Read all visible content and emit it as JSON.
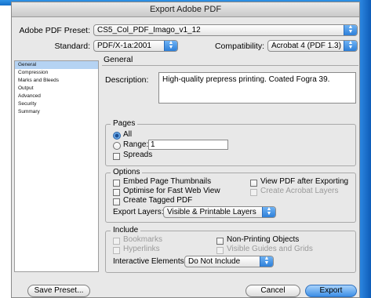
{
  "window": {
    "title": "Export Adobe PDF"
  },
  "preset": {
    "label": "Adobe PDF Preset:",
    "value": "CS5_Col_PDF_Imago_v1_12"
  },
  "standard": {
    "label": "Standard:",
    "value": "PDF/X-1a:2001"
  },
  "compatibility": {
    "label": "Compatibility:",
    "value": "Acrobat 4 (PDF 1.3)"
  },
  "sidebar": {
    "items": [
      {
        "label": "General",
        "selected": true
      },
      {
        "label": "Compression"
      },
      {
        "label": "Marks and Bleeds"
      },
      {
        "label": "Output"
      },
      {
        "label": "Advanced"
      },
      {
        "label": "Security"
      },
      {
        "label": "Summary"
      }
    ]
  },
  "general": {
    "title": "General",
    "description_label": "Description:",
    "description_value": "High-quality prepress printing.  Coated Fogra 39."
  },
  "pages": {
    "title": "Pages",
    "all_label": "All",
    "range_label": "Range:",
    "range_value": "1",
    "spreads_label": "Spreads"
  },
  "options": {
    "title": "Options",
    "embed_thumbnails": "Embed Page Thumbnails",
    "optimise_web": "Optimise for Fast Web View",
    "tagged_pdf": "Create Tagged PDF",
    "view_after": "View PDF after Exporting",
    "acrobat_layers": "Create Acrobat Layers",
    "export_layers_label": "Export Layers:",
    "export_layers_value": "Visible & Printable Layers"
  },
  "include": {
    "title": "Include",
    "bookmarks": "Bookmarks",
    "hyperlinks": "Hyperlinks",
    "non_printing": "Non-Printing Objects",
    "visible_guides": "Visible Guides and Grids",
    "interactive_label": "Interactive Elements:",
    "interactive_value": "Do Not Include"
  },
  "footer": {
    "save_preset": "Save Preset...",
    "cancel": "Cancel",
    "export": "Export"
  }
}
